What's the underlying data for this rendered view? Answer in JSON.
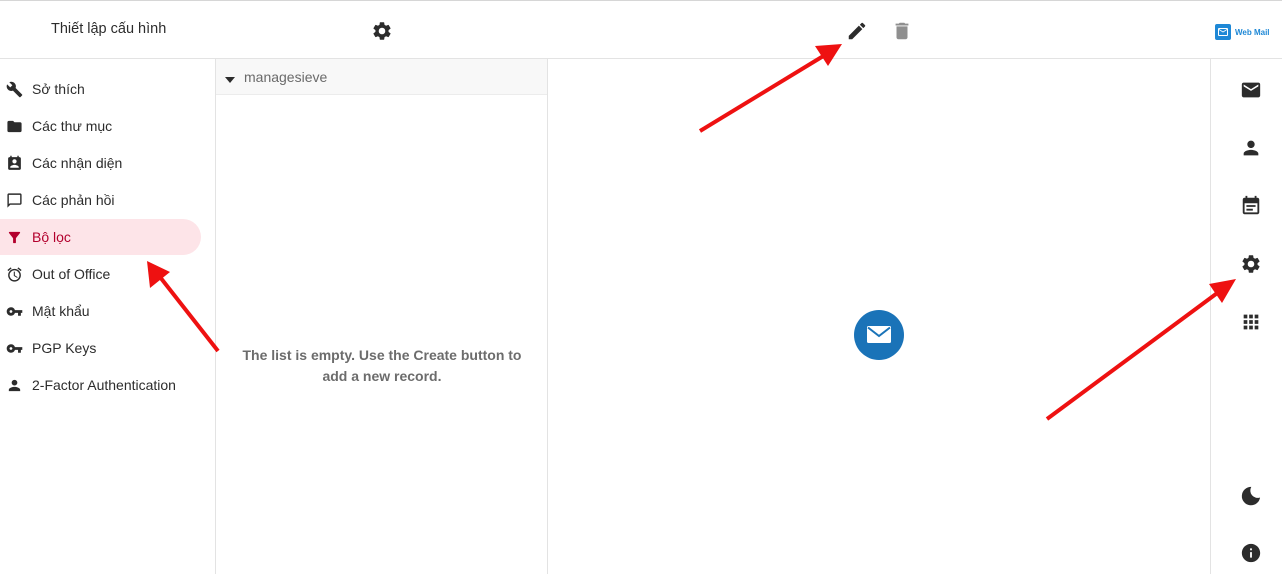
{
  "header": {
    "title": "Thiết lập cấu hình",
    "settings_icon": "gear-icon",
    "edit_icon": "pencil-icon",
    "delete_icon": "trash-icon",
    "logo_text": "Web Mail",
    "logo_color": "#1e88d6"
  },
  "sidebar": {
    "items": [
      {
        "label": "Sở thích",
        "icon": "wrench-icon"
      },
      {
        "label": "Các thư mục",
        "icon": "folder-icon"
      },
      {
        "label": "Các nhận diện",
        "icon": "contact-card-icon"
      },
      {
        "label": "Các phản hồi",
        "icon": "chat-bubble-icon"
      },
      {
        "label": "Bộ lọc",
        "icon": "filter-icon",
        "active": true
      },
      {
        "label": "Out of Office",
        "icon": "alarm-clock-icon"
      },
      {
        "label": "Mật khẩu",
        "icon": "key-icon"
      },
      {
        "label": "PGP Keys",
        "icon": "key-icon"
      },
      {
        "label": "2-Factor Authentication",
        "icon": "person-icon"
      }
    ],
    "active_bg": "#fde4e8",
    "active_color": "#b3002d"
  },
  "list": {
    "group_label": "managesieve",
    "empty_message": "The list is empty. Use the Create button to add a new record."
  },
  "content": {
    "placeholder_icon": "mail-circle-icon",
    "placeholder_color": "#1a73b8"
  },
  "rightbar": {
    "icons": [
      "mail-icon",
      "person-icon",
      "calendar-icon",
      "gear-icon",
      "apps-grid-icon",
      "moon-icon",
      "info-icon"
    ]
  },
  "annotations": {
    "arrow_color": "#ee1111"
  }
}
